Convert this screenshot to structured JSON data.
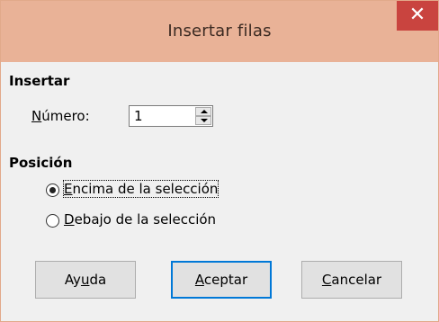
{
  "window": {
    "title": "Insertar filas",
    "close_symbol": "✕"
  },
  "insert": {
    "section_title": "Insertar",
    "number_label_prefix": "",
    "number_label_mnemonic": "N",
    "number_label_rest": "úmero:",
    "number_value": "1"
  },
  "position": {
    "section_title": "Posición",
    "options": [
      {
        "mnemonic": "E",
        "rest": "ncima de la selección",
        "selected": true
      },
      {
        "mnemonic": "D",
        "rest": "ebajo de la selección",
        "selected": false
      }
    ]
  },
  "buttons": {
    "help": {
      "pre": "Ay",
      "mnemonic": "u",
      "post": "da"
    },
    "ok": {
      "pre": "",
      "mnemonic": "A",
      "post": "ceptar"
    },
    "cancel": {
      "pre": "",
      "mnemonic": "C",
      "post": "ancelar"
    }
  },
  "colors": {
    "titlebar": "#e9b297",
    "close_button": "#c9443f",
    "default_button_border": "#0078d7"
  }
}
